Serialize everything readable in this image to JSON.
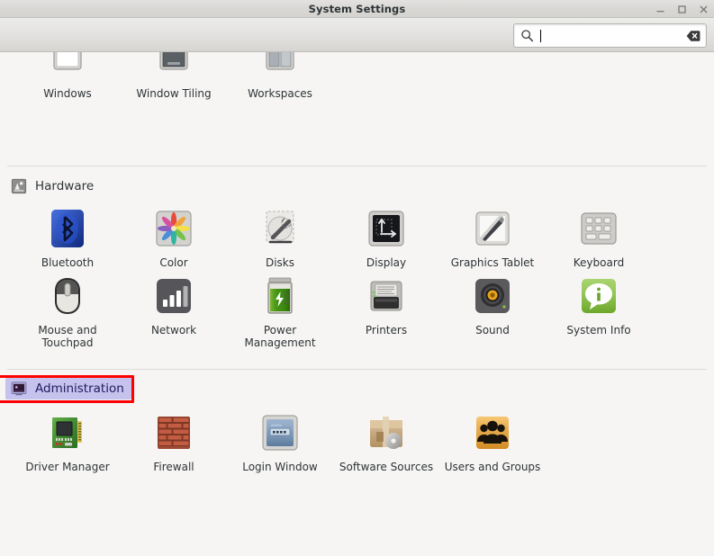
{
  "window": {
    "title": "System Settings",
    "controls": [
      {
        "name": "minimize",
        "glyph": "minimize-icon"
      },
      {
        "name": "maximize",
        "glyph": "maximize-icon"
      },
      {
        "name": "close",
        "glyph": "close-icon"
      }
    ]
  },
  "search": {
    "value": "",
    "placeholder": "",
    "icon": "search-icon",
    "clear_icon": "clear-icon"
  },
  "annotation": {
    "color": "#ff0000",
    "target": "Administration"
  },
  "sections": [
    {
      "id": "preferences-partial",
      "title": "",
      "icon": "",
      "selected": false,
      "clipped": true,
      "items": [
        {
          "label": "Windows",
          "icon": "windows-icon"
        },
        {
          "label": "Window Tiling",
          "icon": "window-tiling-icon"
        },
        {
          "label": "Workspaces",
          "icon": "workspaces-icon"
        }
      ]
    },
    {
      "id": "hardware",
      "title": "Hardware",
      "icon": "hardware-icon",
      "selected": false,
      "clipped": false,
      "items": [
        {
          "label": "Bluetooth",
          "icon": "bluetooth-icon"
        },
        {
          "label": "Color",
          "icon": "color-icon"
        },
        {
          "label": "Disks",
          "icon": "disks-icon"
        },
        {
          "label": "Display",
          "icon": "display-icon"
        },
        {
          "label": "Graphics Tablet",
          "icon": "graphics-tablet-icon"
        },
        {
          "label": "Keyboard",
          "icon": "keyboard-icon"
        },
        {
          "label": "Mouse and Touchpad",
          "icon": "mouse-touchpad-icon"
        },
        {
          "label": "Network",
          "icon": "network-icon"
        },
        {
          "label": "Power Management",
          "icon": "power-management-icon"
        },
        {
          "label": "Printers",
          "icon": "printers-icon"
        },
        {
          "label": "Sound",
          "icon": "sound-icon"
        },
        {
          "label": "System Info",
          "icon": "system-info-icon"
        }
      ]
    },
    {
      "id": "administration",
      "title": "Administration",
      "icon": "administration-icon",
      "selected": true,
      "clipped": false,
      "items": [
        {
          "label": "Driver Manager",
          "icon": "driver-manager-icon"
        },
        {
          "label": "Firewall",
          "icon": "firewall-icon"
        },
        {
          "label": "Login Window",
          "icon": "login-window-icon"
        },
        {
          "label": "Software Sources",
          "icon": "software-sources-icon"
        },
        {
          "label": "Users and Groups",
          "icon": "users-groups-icon"
        }
      ]
    }
  ],
  "colors": {
    "selection_bg": "#c5c2ee",
    "selection_fg": "#241a5e",
    "annotation": "#ff0000",
    "content_bg": "#f6f5f4",
    "titlebar_bg": "#d9d8d5"
  }
}
